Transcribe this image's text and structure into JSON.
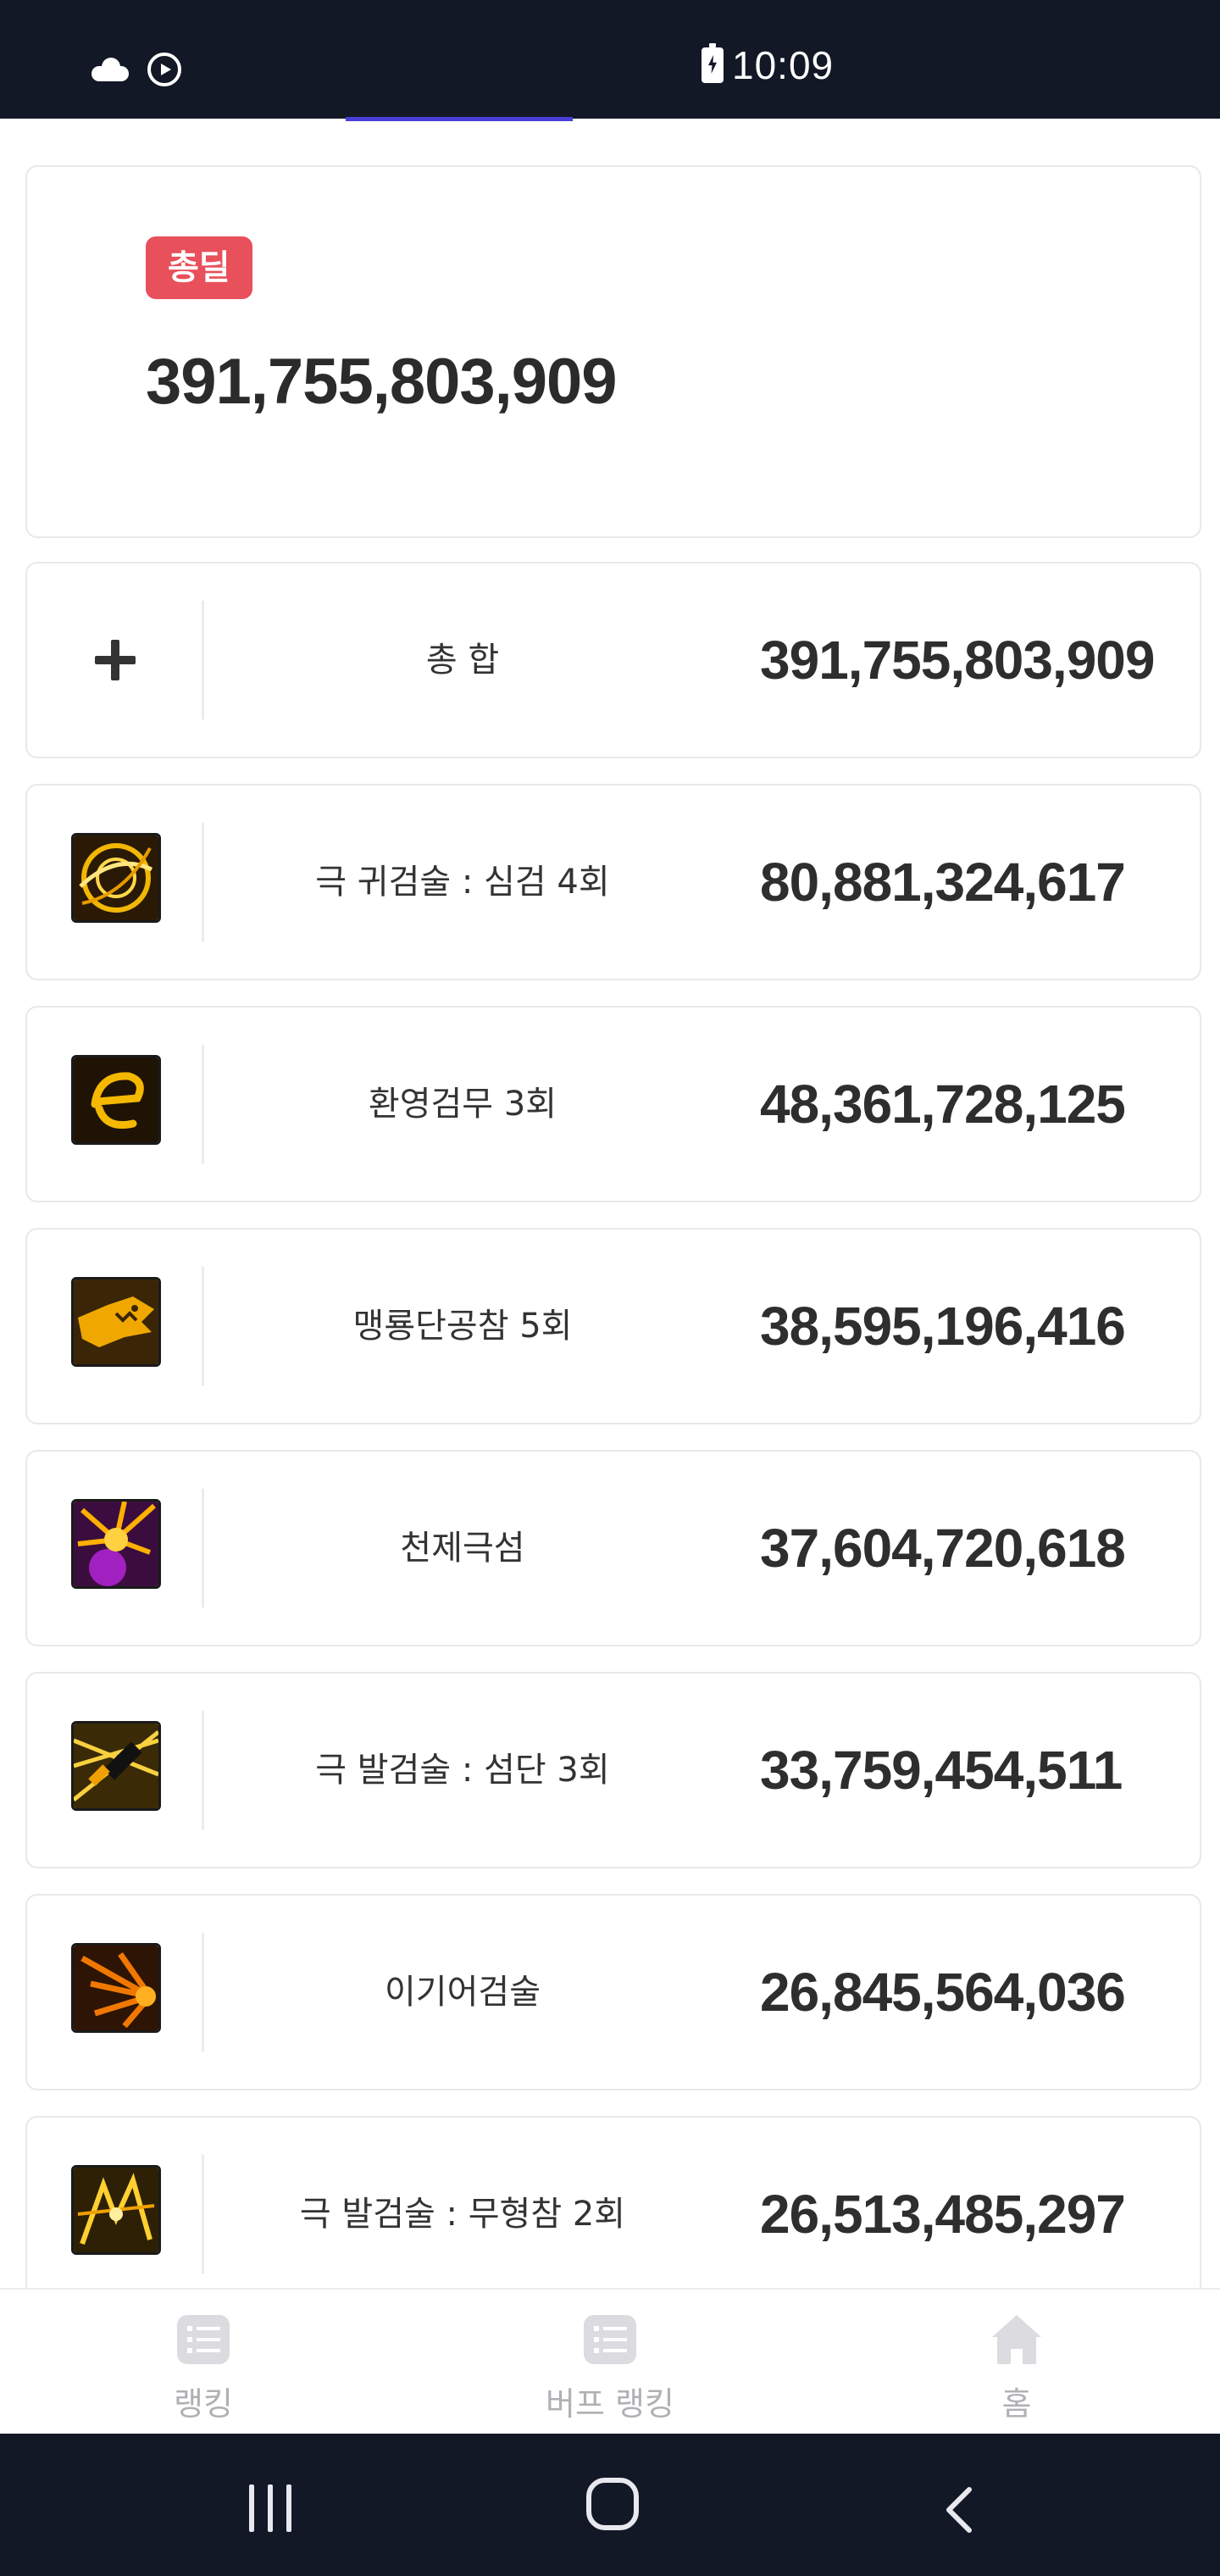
{
  "status_bar": {
    "time": "10:09",
    "left_icons": [
      "cloud-icon",
      "play-circle-icon"
    ],
    "right_icons": [
      "battery-charging-icon"
    ]
  },
  "summary": {
    "badge": "총딜",
    "total": "391,755,803,909",
    "badge_color": "#e8505b"
  },
  "total_row": {
    "icon": "plus-icon",
    "name": "총 합",
    "value": "391,755,803,909"
  },
  "skills": [
    {
      "icon": "skill-ghost-sword-icon",
      "name": "극 귀검술 : 심검 4회",
      "value": "80,881,324,617"
    },
    {
      "icon": "skill-phantom-dance-icon",
      "name": "환영검무 3회",
      "value": "48,361,728,125"
    },
    {
      "icon": "skill-dragon-slash-icon",
      "name": "맹룡단공참 5회",
      "value": "38,595,196,416"
    },
    {
      "icon": "skill-heaven-flash-icon",
      "name": "천제극섬",
      "value": "37,604,720,618"
    },
    {
      "icon": "skill-draw-sword-icon",
      "name": "극 발검술 : 섬단 3회",
      "value": "33,759,454,511"
    },
    {
      "icon": "skill-igi-sword-icon",
      "name": "이기어검술",
      "value": "26,845,564,036"
    },
    {
      "icon": "skill-formless-slash-icon",
      "name": "극 발검술 : 무형참 2회",
      "value": "26,513,485,297"
    }
  ],
  "bottom_nav": [
    {
      "label": "랭킹",
      "icon": "list-icon"
    },
    {
      "label": "버프 랭킹",
      "icon": "list-icon"
    },
    {
      "label": "홈",
      "icon": "home-icon"
    }
  ],
  "system_nav": [
    "recent-apps-icon",
    "home-button-icon",
    "back-icon"
  ],
  "colors": {
    "accent_tab": "#4a3fd6",
    "status_bar_bg": "#121826",
    "nav_inactive": "#b0b0b5"
  }
}
